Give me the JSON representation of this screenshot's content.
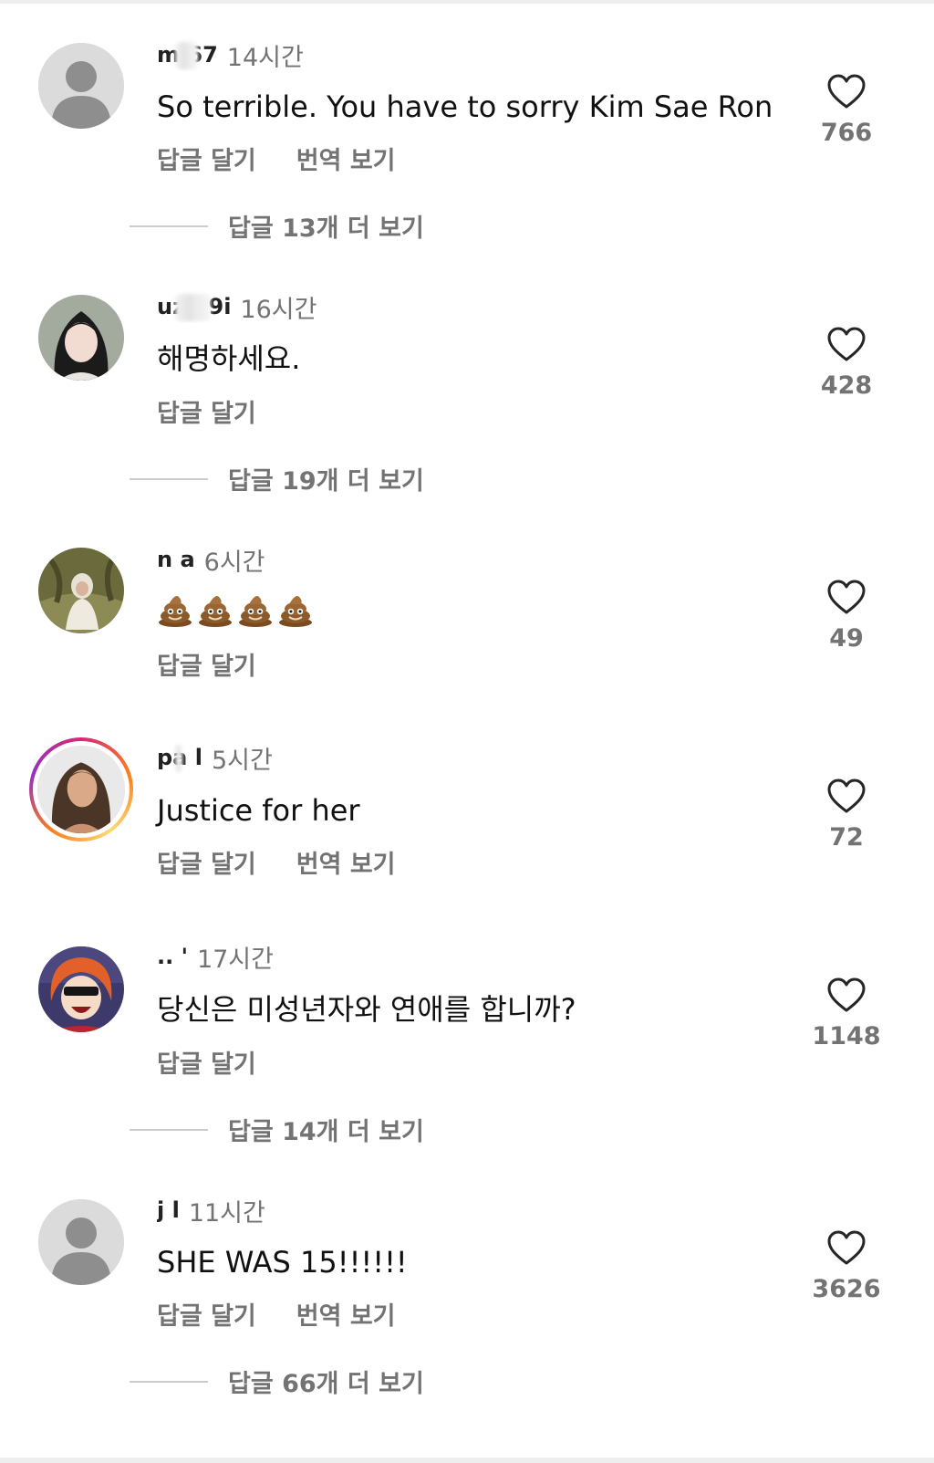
{
  "comments": [
    {
      "username": "m                  67",
      "time": "14시간",
      "text": "So terrible. You have to sorry Kim Sae Ron",
      "reply_label": "답글 달기",
      "translate_label": "번역 보기",
      "likes": "766",
      "more_replies": "답글 13개 더 보기",
      "avatar": "default"
    },
    {
      "username": "uzu          9i",
      "time": "16시간",
      "text": "해명하세요.",
      "reply_label": "답글 달기",
      "likes": "428",
      "more_replies": "답글 19개 더 보기",
      "avatar": "photo-girl"
    },
    {
      "username": "n               a",
      "time": "6시간",
      "text": "💩💩💩💩",
      "reply_label": "답글 달기",
      "likes": "49",
      "avatar": "photo-hijab"
    },
    {
      "username": "pa               l",
      "time": "5시간",
      "text": "Justice for her",
      "reply_label": "답글 달기",
      "translate_label": "번역 보기",
      "likes": "72",
      "avatar": "photo-woman-story"
    },
    {
      "username": "..              '",
      "time": "17시간",
      "text": "당신은 미성년자와 연애를 합니까?",
      "reply_label": "답글 달기",
      "likes": "1148",
      "more_replies": "답글 14개 더 보기",
      "avatar": "anime"
    },
    {
      "username": "j              l",
      "time": "11시간",
      "text": "SHE WAS 15!!!!!!",
      "reply_label": "답글 달기",
      "translate_label": "번역 보기",
      "likes": "3626",
      "more_replies": "답글 66개 더 보기",
      "avatar": "default"
    }
  ]
}
